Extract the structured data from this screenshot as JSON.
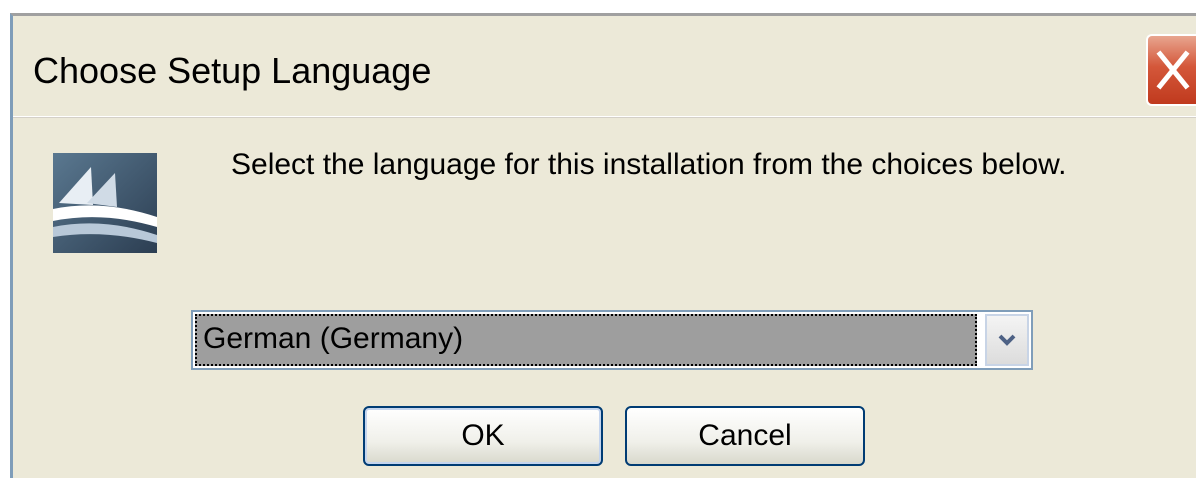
{
  "window": {
    "title": "Choose Setup Language"
  },
  "dialog": {
    "prompt": "Select the language for this installation from the choices below.",
    "language_select": {
      "selected": "German (Germany)"
    },
    "buttons": {
      "ok": "OK",
      "cancel": "Cancel"
    }
  },
  "icons": {
    "close": "close-icon",
    "app": "installer-logo-icon",
    "dropdown": "chevron-down-icon"
  },
  "colors": {
    "dialog_bg": "#ece9d8",
    "close_red": "#d4573a",
    "button_border": "#003c74",
    "selection_bg": "#9e9e9e"
  }
}
